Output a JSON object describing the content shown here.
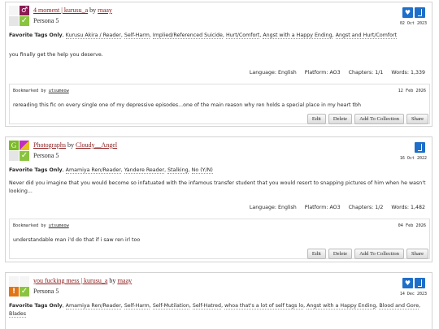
{
  "bookmarks": [
    {
      "title": "4 moment | kurusu_a",
      "by_word": "by",
      "author": "rnaay",
      "fandom": "Persona 5",
      "req_text": {
        "category": "♂",
        "rating": "",
        "check": "✓"
      },
      "date": "02 Oct 2023",
      "fav_tag": "Favorite Tags Only",
      "tags": [
        "Kurusu Akira / Reader",
        "Self-Harm",
        "Implied/Referenced Suicide",
        "Hurt/Comfort",
        "Angst with a Happy Ending",
        "Angst and Hurt/Comfort"
      ],
      "summary": "you finally get the help you deserve.",
      "stats": {
        "language": "Language: English",
        "platform": "Platform: AO3",
        "chapters": "Chapters: 1/1",
        "words": "Words: 1,339"
      },
      "bookmarker_label": "Bookmarked by",
      "bookmarker": "utsumeow",
      "bookmark_date": "12 Feb 2026",
      "note": "rereading this fic on every single one of my depressive episodes...one of the main reason why ren holds a special place in my heart tbh",
      "actions": [
        "Edit",
        "Delete",
        "Add To Collection",
        "Share"
      ]
    },
    {
      "title": "Photographs",
      "by_word": "by",
      "author": "Cloudy__Angel",
      "fandom": "Persona 5",
      "req_text": {
        "category": "",
        "rating": "G",
        "check": "✓"
      },
      "date": "16 Oct 2022",
      "fav_tag": "Favorite Tags Only",
      "tags": [
        "Amamiya Ren/Reader",
        "Yandere Reader",
        "Stalking",
        "No (Y/N)"
      ],
      "summary": "Never did you imagine that you would become so infatuated with the infamous transfer student that you would resort to snapping pictures of him when he wasn't looking...",
      "stats": {
        "language": "Language: English",
        "platform": "Platform: AO3",
        "chapters": "Chapters: 1/2",
        "words": "Words: 1,482"
      },
      "bookmarker_label": "Bookmarked by",
      "bookmarker": "utsumeow",
      "bookmark_date": "04 Feb 2026",
      "note": "understandable man i'd do that if i saw ren irl too",
      "actions": [
        "Edit",
        "Delete",
        "Add To Collection",
        "Share"
      ]
    },
    {
      "title": "you fucking mess | kurusu_a",
      "by_word": "by",
      "author": "rnaay",
      "fandom": "Persona 5",
      "req_text": {
        "category": "",
        "rating": "!",
        "check": "✓"
      },
      "date": "14 Dec 2023",
      "fav_tag": "Favorite Tags Only",
      "tags": [
        "Amamiya Ren/Reader",
        "Self-Harm",
        "Self-Mutilation",
        "Self-Hatred",
        "whoa that's a lot of self tags lo",
        "Angst with a Happy Ending",
        "Blood and Gore",
        "Blades"
      ]
    }
  ],
  "colors": {
    "link": "#8b1a1a",
    "accent_blue": "#1e6fc9",
    "check_green": "#8ac43f"
  },
  "icons": {
    "kudos": "heart-icon",
    "bookmark": "bookmark-icon"
  }
}
